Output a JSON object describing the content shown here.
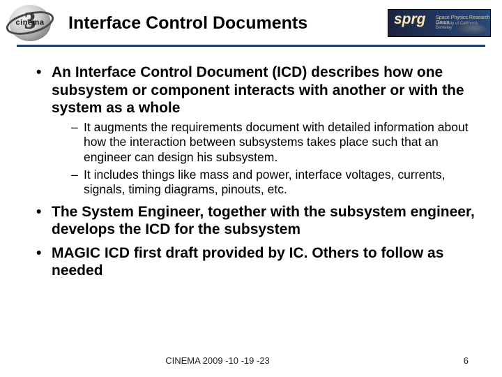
{
  "logo_left": {
    "numeral": "3",
    "word": "cinema"
  },
  "logo_right": {
    "acronym": "sprg",
    "line1": "Space Physics Research Group",
    "line2": "University of California, Berkeley"
  },
  "title": "Interface Control Documents",
  "bullets": {
    "b1": "An Interface Control Document (ICD) describes how one subsystem or component interacts with another or with the system as a whole",
    "b1_subs": {
      "s1": "It augments the requirements document with detailed information about how the interaction between subsystems takes place such that an engineer can design his subsystem.",
      "s2": "It includes things like mass and power, interface voltages, currents, signals, timing diagrams, pinouts, etc."
    },
    "b2": "The System Engineer, together with the subsystem engineer, develops the ICD for the subsystem",
    "b3": "MAGIC ICD first draft provided by IC.  Others to follow as needed"
  },
  "footer": {
    "text": "CINEMA 2009 -10 -19 -23",
    "page": "6"
  }
}
